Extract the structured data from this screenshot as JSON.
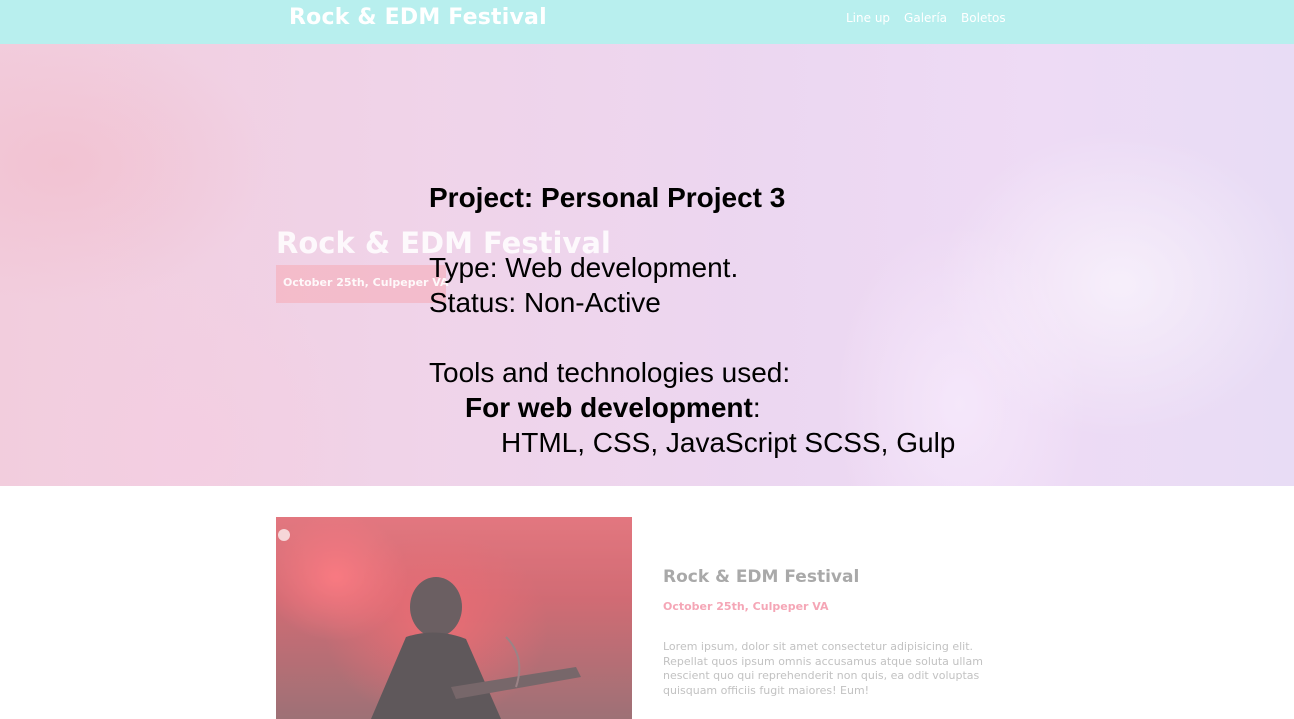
{
  "header": {
    "site_title": "Rock & EDM Festival",
    "nav": [
      "Line up",
      "Galería",
      "Boletos"
    ]
  },
  "hero": {
    "title": "Rock & EDM Festival",
    "date": "October 25th, Culpeper VA"
  },
  "info": {
    "project": "Project: Personal Project 3",
    "type": "Type: Web development.",
    "status": "Status: Non-Active",
    "tools_heading": "Tools and technologies used:",
    "web_dev_label": "For web development",
    "web_dev_colon": ":",
    "web_dev_tools": "HTML, CSS, JavaScript SCSS, Gulp"
  },
  "card": {
    "title": "Rock & EDM Festival",
    "date": "October 25th, Culpeper VA",
    "body": "Lorem ipsum, dolor sit amet consectetur adipisicing elit. Repellat quos ipsum omnis accusamus atque soluta ullam nescient quo qui reprehenderit non quis, ea odit voluptas quisquam officiis fugit maiores! Eum!"
  },
  "colors": {
    "header_bg": "#b8efee",
    "accent_pink": "#f5a6b6"
  }
}
